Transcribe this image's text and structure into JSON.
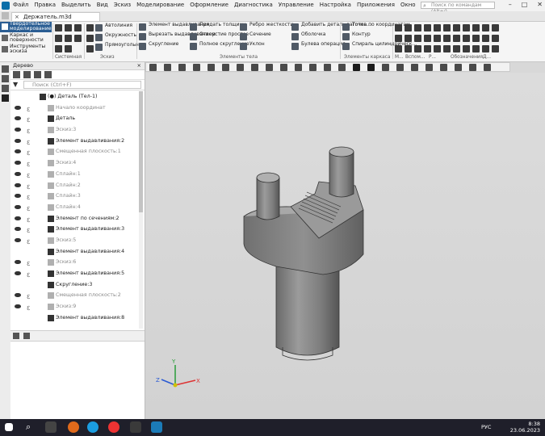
{
  "window": {
    "menu": [
      "Файл",
      "Правка",
      "Выделить",
      "Вид",
      "Эскиз",
      "Моделирование",
      "Оформление",
      "Диагностика",
      "Управление",
      "Настройка",
      "Приложения",
      "Окно",
      "Справка"
    ],
    "search_placeholder": "Поиск по командам (Alt+/)",
    "tab_title": "Держатель.m3d"
  },
  "ribbon": {
    "modes": [
      "Твердотельное моделирование",
      "Каркас и поверхности",
      "Инструменты эскиза"
    ],
    "groups": {
      "system_label": "Системная",
      "sketch_label": "Эскиз",
      "sketch_items": [
        "Автолиния",
        "Окружность",
        "Прямоугольник"
      ],
      "body_label": "Элементы тела",
      "body_items_col1": [
        "Элемент выдавливания",
        "Вырезать выдавливанием",
        "Скругление"
      ],
      "body_items_col2": [
        "Придать толщину",
        "Отверстие простое",
        "Полное скругление"
      ],
      "body_items_col3": [
        "Ребро жесткости",
        "Сечение",
        "Уклон"
      ],
      "body_items_col4": [
        "Добавить деталь-заготов...",
        "Оболочка",
        "Булева операция"
      ],
      "frame_label": "Элементы каркаса",
      "frame_items": [
        "Точка по координатам",
        "Контур",
        "Спираль цилиндрическ..."
      ],
      "tail_labels": [
        "М...",
        "Вспом...",
        "Р...",
        "Обозначения",
        "Д..."
      ]
    }
  },
  "tree": {
    "title": "Дерево",
    "filter_placeholder": "Поиск (Ctrl+F)",
    "rows": [
      {
        "label": "(●) Деталь (Тел-1)",
        "indent": 0,
        "eye": false,
        "dim": false,
        "bold": true
      },
      {
        "label": "Начало координат",
        "indent": 1,
        "eye": true,
        "dim": true
      },
      {
        "label": "Деталь",
        "indent": 1,
        "eye": true,
        "dim": false
      },
      {
        "label": "Эскиз:3",
        "indent": 1,
        "eye": true,
        "dim": true
      },
      {
        "label": "Элемент выдавливания:2",
        "indent": 1,
        "eye": true,
        "dim": false
      },
      {
        "label": "Смещенная плоскость:1",
        "indent": 1,
        "eye": true,
        "dim": true
      },
      {
        "label": "Эскиз:4",
        "indent": 1,
        "eye": true,
        "dim": true
      },
      {
        "label": "Сплайн:1",
        "indent": 1,
        "eye": true,
        "dim": true
      },
      {
        "label": "Сплайн:2",
        "indent": 1,
        "eye": true,
        "dim": true
      },
      {
        "label": "Сплайн:3",
        "indent": 1,
        "eye": true,
        "dim": true
      },
      {
        "label": "Сплайн:4",
        "indent": 1,
        "eye": true,
        "dim": true
      },
      {
        "label": "Элемент по сечениям:2",
        "indent": 1,
        "eye": true,
        "dim": false
      },
      {
        "label": "Элемент выдавливания:3",
        "indent": 1,
        "eye": true,
        "dim": false
      },
      {
        "label": "Эскиз:5",
        "indent": 1,
        "eye": true,
        "dim": true
      },
      {
        "label": "Элемент выдавливания:4",
        "indent": 1,
        "eye": false,
        "dim": false
      },
      {
        "label": "Эскиз:6",
        "indent": 1,
        "eye": true,
        "dim": true
      },
      {
        "label": "Элемент выдавливания:5",
        "indent": 1,
        "eye": true,
        "dim": false
      },
      {
        "label": "Скругление:3",
        "indent": 1,
        "eye": false,
        "dim": false
      },
      {
        "label": "Смещенная плоскость:2",
        "indent": 1,
        "eye": true,
        "dim": true
      },
      {
        "label": "Эскиз:9",
        "indent": 1,
        "eye": true,
        "dim": true
      },
      {
        "label": "Элемент выдавливания:8",
        "indent": 1,
        "eye": false,
        "dim": false
      }
    ]
  },
  "viewport": {
    "axis_labels": {
      "x": "X",
      "y": "Y",
      "z": "Z"
    }
  },
  "taskbar": {
    "lang": "РУС",
    "time": "8:38",
    "date": "23.06.2023"
  }
}
